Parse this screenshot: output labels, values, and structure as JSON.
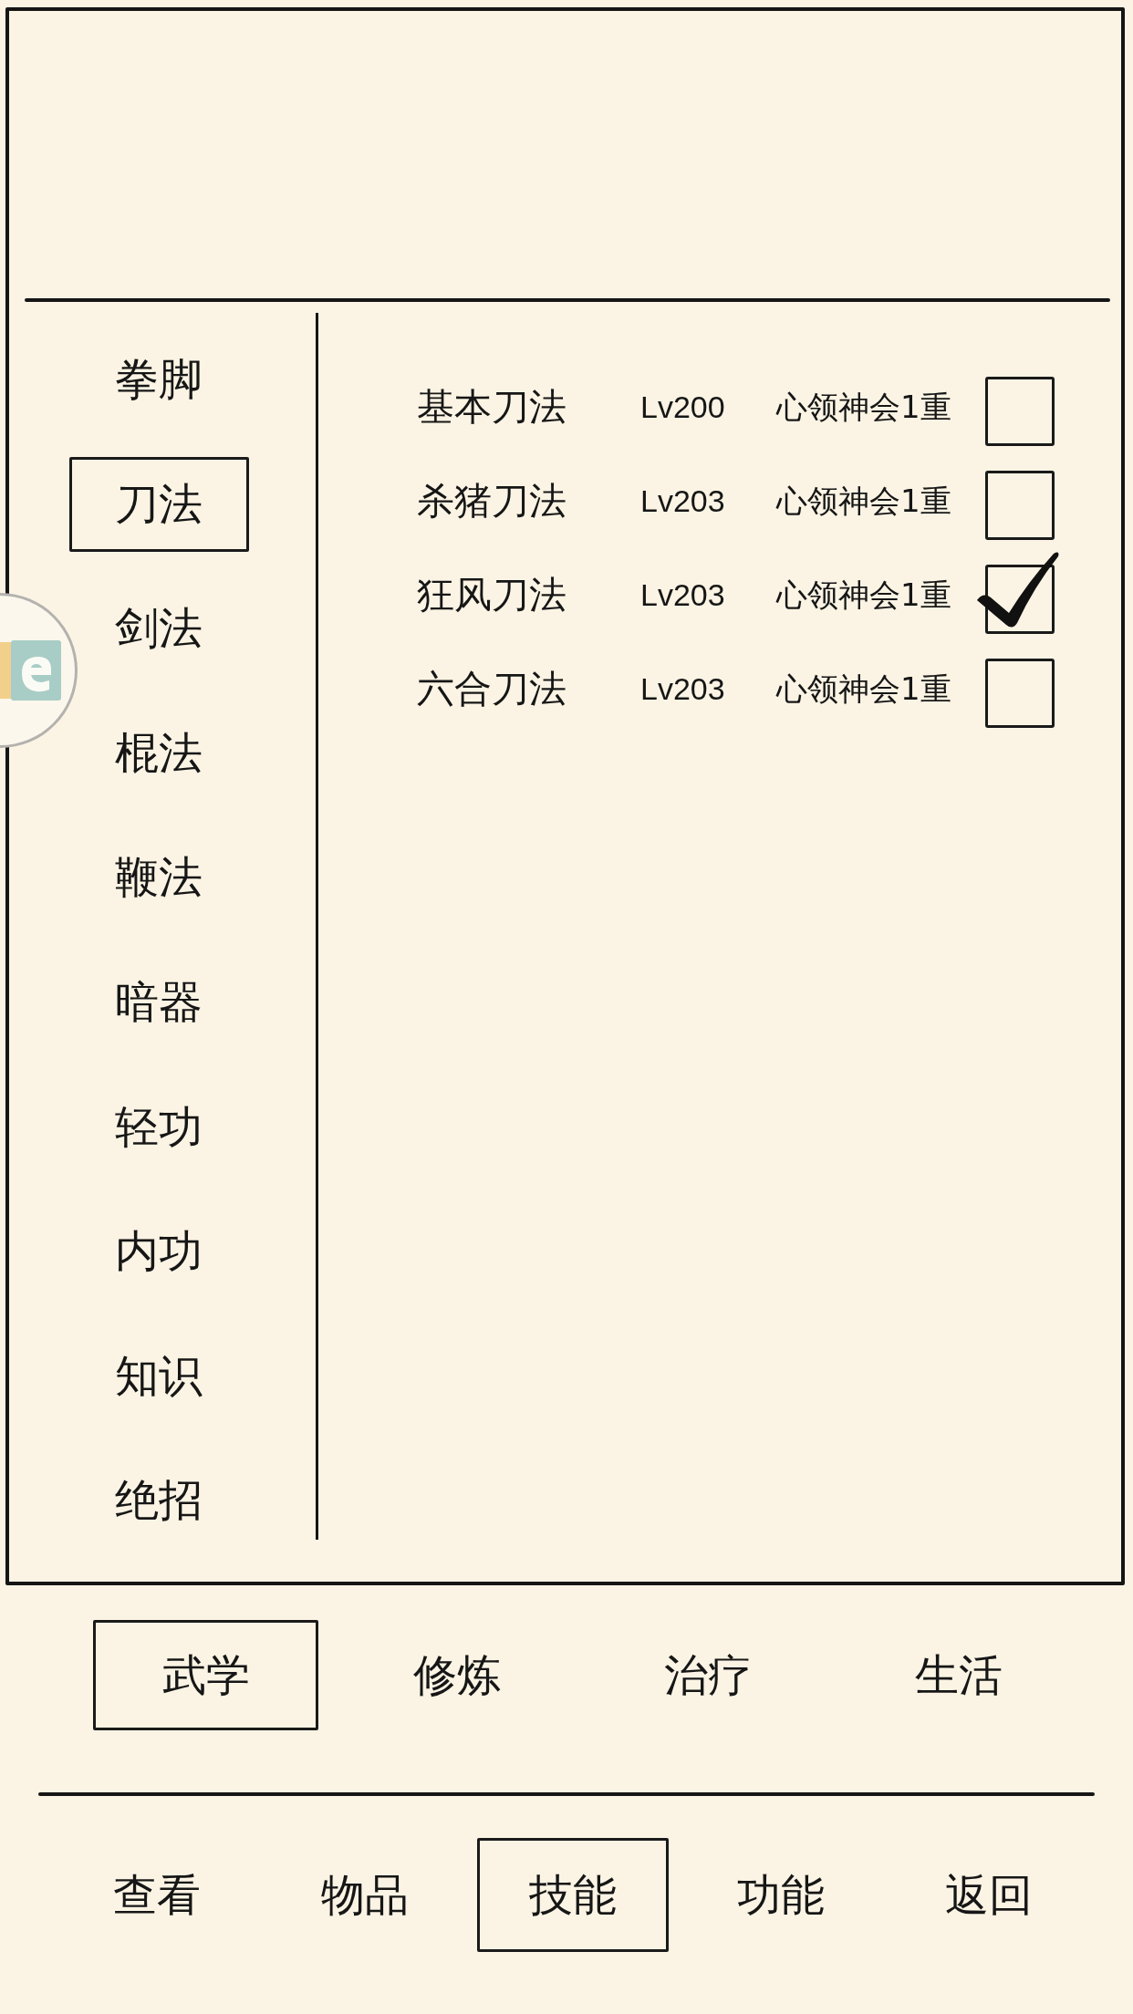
{
  "side_categories": [
    {
      "label": "拳脚",
      "selected": false
    },
    {
      "label": "刀法",
      "selected": true
    },
    {
      "label": "剑法",
      "selected": false
    },
    {
      "label": "棍法",
      "selected": false
    },
    {
      "label": "鞭法",
      "selected": false
    },
    {
      "label": "暗器",
      "selected": false
    },
    {
      "label": "轻功",
      "selected": false
    },
    {
      "label": "内功",
      "selected": false
    },
    {
      "label": "知识",
      "selected": false
    },
    {
      "label": "绝招",
      "selected": false
    }
  ],
  "skills": [
    {
      "name": "基本刀法",
      "lv": "Lv200",
      "mastery": "心领神会1重",
      "checked": false
    },
    {
      "name": "杀猪刀法",
      "lv": "Lv203",
      "mastery": "心领神会1重",
      "checked": false
    },
    {
      "name": "狂风刀法",
      "lv": "Lv203",
      "mastery": "心领神会1重",
      "checked": true
    },
    {
      "name": "六合刀法",
      "lv": "Lv203",
      "mastery": "心领神会1重",
      "checked": false
    }
  ],
  "sub_tabs": [
    {
      "label": "武学",
      "selected": true
    },
    {
      "label": "修炼",
      "selected": false
    },
    {
      "label": "治疗",
      "selected": false
    },
    {
      "label": "生活",
      "selected": false
    }
  ],
  "nav_tabs": [
    {
      "label": "查看",
      "selected": false
    },
    {
      "label": "物品",
      "selected": false
    },
    {
      "label": "技能",
      "selected": true
    },
    {
      "label": "功能",
      "selected": false
    },
    {
      "label": "返回",
      "selected": false
    }
  ]
}
